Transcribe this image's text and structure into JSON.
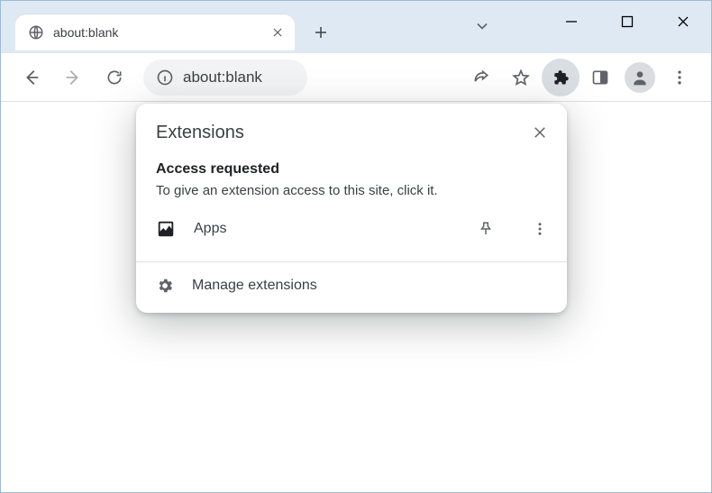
{
  "tab": {
    "title": "about:blank"
  },
  "omnibox": {
    "value": "about:blank"
  },
  "popup": {
    "title": "Extensions",
    "section_title": "Access requested",
    "section_body": "To give an extension access to this site, click it.",
    "extension_name": "Apps",
    "manage_label": "Manage extensions"
  },
  "icons": {
    "globe": "globe-icon",
    "tab_close": "close-icon",
    "newtab": "plus-icon",
    "down": "chevron-down-icon",
    "win_min": "minimize-icon",
    "win_max": "maximize-icon",
    "win_close": "close-icon",
    "back": "back-icon",
    "forward": "forward-icon",
    "reload": "reload-icon",
    "info": "info-icon",
    "share": "share-icon",
    "star": "bookmark-icon",
    "puzzle": "extensions-icon",
    "panel": "side-panel-icon",
    "profile": "profile-icon",
    "menu": "kebab-menu-icon",
    "popup_close": "close-icon",
    "ext_app": "apps-extension-icon",
    "pin": "pin-icon",
    "ext_menu": "kebab-menu-icon",
    "gear": "gear-icon"
  }
}
